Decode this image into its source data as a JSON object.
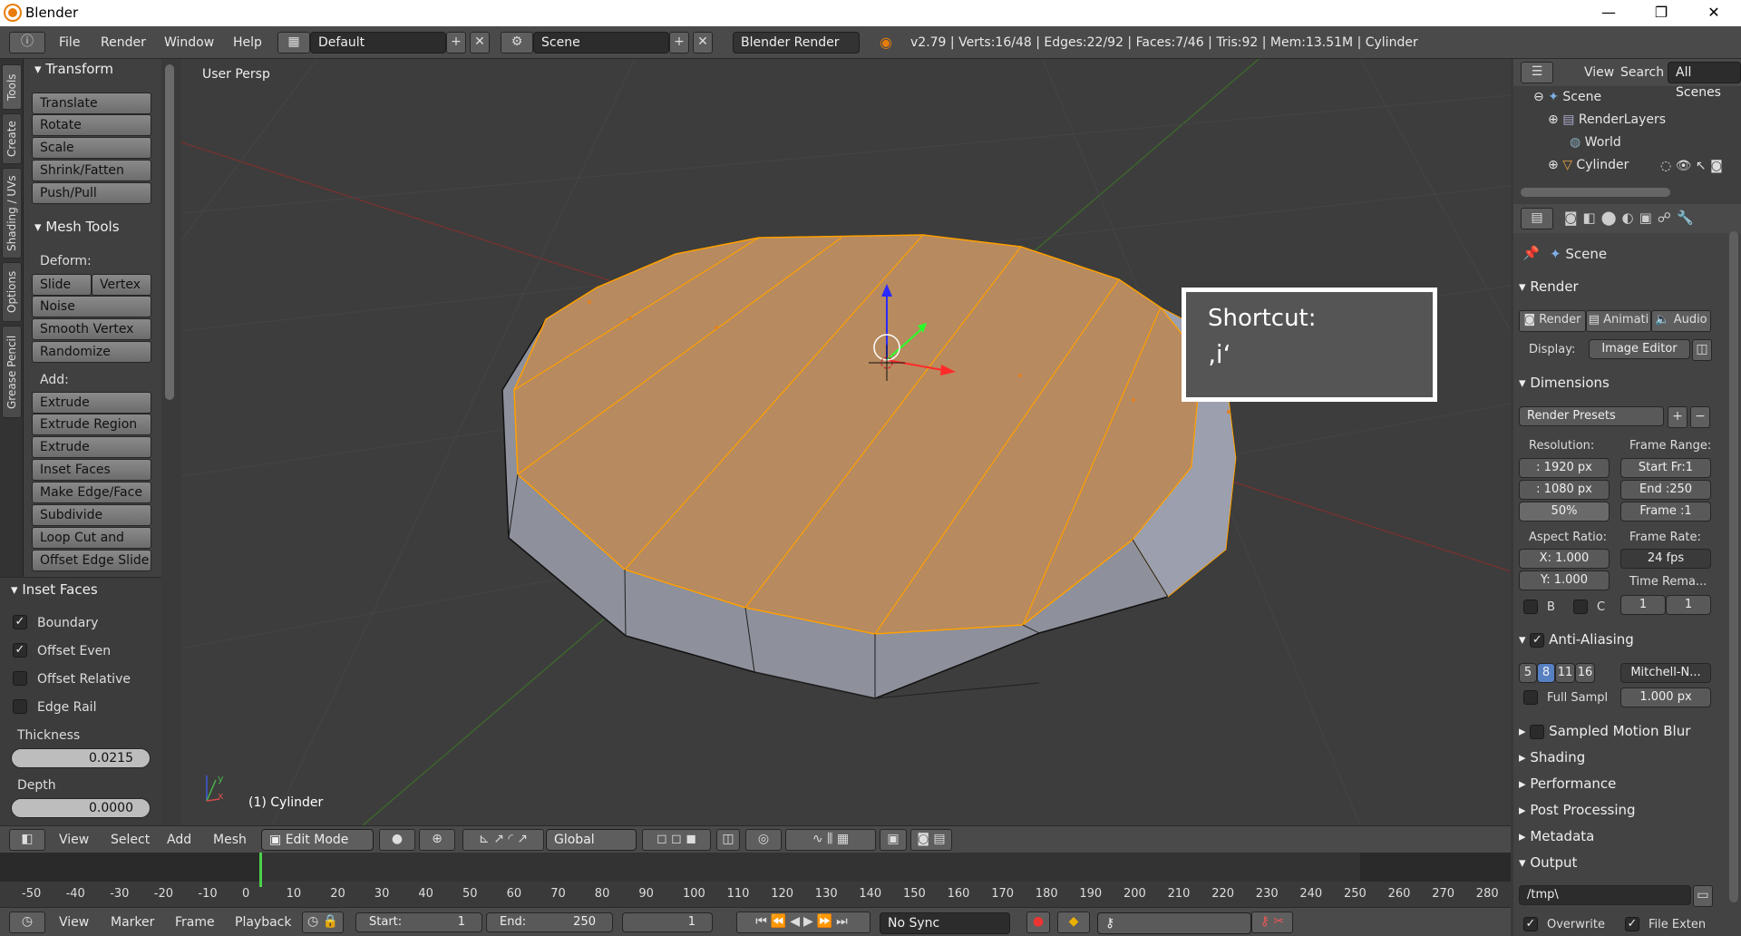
{
  "window": {
    "title": "Blender",
    "min": "—",
    "max": "❐",
    "close": "✕"
  },
  "menu": {
    "file": "File",
    "render": "Render",
    "window": "Window",
    "help": "Help"
  },
  "layout_field": "Default",
  "scene_field": "Scene",
  "engine": "Blender Render",
  "stats": "v2.79 | Verts:16/48 | Edges:22/92 | Faces:7/46 | Tris:92 | Mem:13.51M | Cylinder",
  "tabs": [
    "Tools",
    "Create",
    "Shading / UVs",
    "Options",
    "Grease Pencil"
  ],
  "transform": {
    "title": "Transform",
    "buttons": [
      "Translate",
      "Rotate",
      "Scale",
      "Shrink/Fatten",
      "Push/Pull"
    ]
  },
  "mesh_tools": {
    "title": "Mesh Tools",
    "deform_label": "Deform:",
    "slide_edge": "Slide Ed",
    "vertex": "Vertex",
    "noise": "Noise",
    "smooth_vertex": "Smooth Vertex",
    "randomize": "Randomize",
    "add_label": "Add:",
    "extrude": "Extrude",
    "add_buttons": [
      "Extrude Region",
      "Extrude Individual",
      "Inset Faces",
      "Make Edge/Face",
      "Subdivide",
      "Loop Cut and Sli...",
      "Offset Edge Slide"
    ]
  },
  "inset_faces": {
    "title": "Inset Faces",
    "options": [
      {
        "label": "Boundary",
        "checked": true
      },
      {
        "label": "Offset Even",
        "checked": true
      },
      {
        "label": "Offset Relative",
        "checked": false
      },
      {
        "label": "Edge Rail",
        "checked": false
      }
    ],
    "thickness_label": "Thickness",
    "thickness": "0.0215",
    "depth_label": "Depth",
    "depth": "0.0000"
  },
  "viewport": {
    "view_name": "User Persp",
    "object_label": "(1) Cylinder",
    "shortcut_title": "Shortcut:",
    "shortcut_key": "‚i‘",
    "axis_x": "x",
    "axis_y": "y"
  },
  "outliner": {
    "view": "View",
    "search": "Search",
    "all_scenes": "All Scenes",
    "items": [
      "Scene",
      "RenderLayers",
      "World",
      "Cylinder"
    ]
  },
  "props": {
    "scene": "Scene",
    "render_title": "Render",
    "render_btn": "Render",
    "anim_btn": "Animati",
    "audio_btn": "Audio",
    "display_label": "Display:",
    "display_value": "Image Editor",
    "dimensions_title": "Dimensions",
    "render_presets": "Render Presets",
    "resolution_label": "Resolution:",
    "res_x": ": 1920 px",
    "res_y": ": 1080 px",
    "res_pct": "50%",
    "frame_range_label": "Frame Range:",
    "start": "Start Fr:1",
    "end": "End :250",
    "frame": "Frame :1",
    "aspect_label": "Aspect Ratio:",
    "aspect_x": "X:  1.000",
    "aspect_y": "Y:  1.000",
    "frame_rate_label": "Frame Rate:",
    "fps": "24 fps",
    "time_remap": "Time Rema...",
    "b": "B",
    "c": "C",
    "remap_old": "1",
    "remap_new": "1",
    "aa_title": "Anti-Aliasing",
    "aa_samples": [
      "5",
      "8",
      "11",
      "16"
    ],
    "aa_filter": "Mitchell-N...",
    "full_sample": "Full Sampl",
    "filter_size": "1.000 px",
    "sampled_mb": "Sampled Motion Blur",
    "shading": "Shading",
    "performance": "Performance",
    "post_processing": "Post Processing",
    "metadata": "Metadata",
    "output": "Output",
    "output_path": "/tmp\\",
    "overwrite": "Overwrite",
    "file_ext": "File Exten"
  },
  "vheader": {
    "view": "View",
    "select": "Select",
    "add": "Add",
    "mesh": "Mesh",
    "mode": "Edit Mode",
    "orientation": "Global"
  },
  "timeline": {
    "ticks": [
      "-50",
      "-40",
      "-30",
      "-20",
      "-10",
      "0",
      "10",
      "20",
      "30",
      "40",
      "50",
      "60",
      "70",
      "80",
      "90",
      "100",
      "110",
      "120",
      "130",
      "140",
      "150",
      "160",
      "170",
      "180",
      "190",
      "200",
      "210",
      "220",
      "230",
      "240",
      "250",
      "260",
      "270",
      "280"
    ],
    "current_frame": 0
  },
  "tlheader": {
    "view": "View",
    "marker": "Marker",
    "frame": "Frame",
    "playback": "Playback",
    "start": "Start:",
    "start_val": "1",
    "end": "End:",
    "end_val": "250",
    "current": "1",
    "sync": "No Sync"
  },
  "colors": {
    "selected_face": "#b78a5f",
    "edge_highlight": "#ffa000",
    "mesh_body": "#8f919c",
    "panel": "#404040"
  }
}
